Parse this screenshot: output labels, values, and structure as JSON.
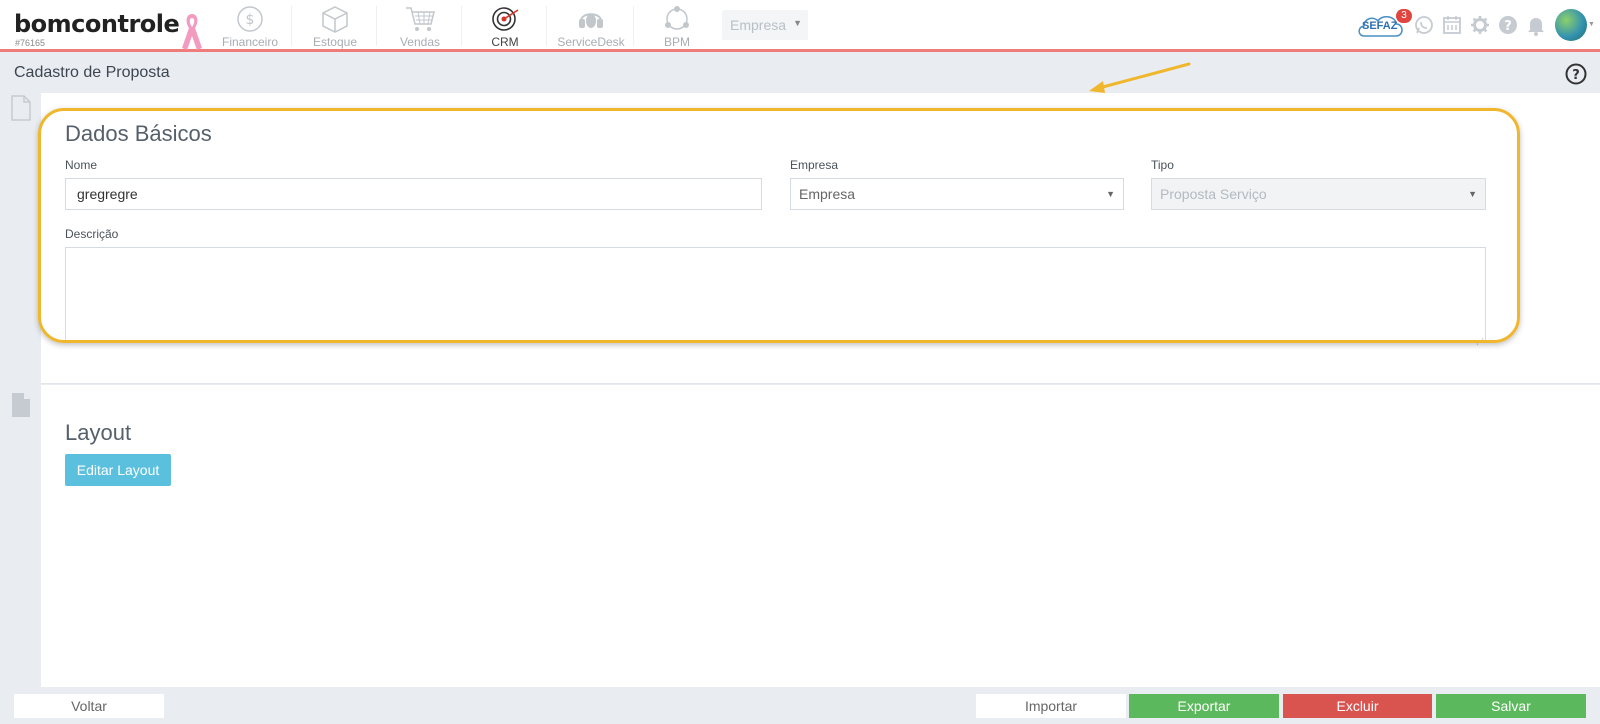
{
  "header": {
    "logo_text": "bomcontrole",
    "account_id": "#76165",
    "modules": [
      {
        "label": "Financeiro",
        "icon": "coin-dollar-icon"
      },
      {
        "label": "Estoque",
        "icon": "box-icon"
      },
      {
        "label": "Vendas",
        "icon": "shopping-cart-icon"
      },
      {
        "label": "CRM",
        "icon": "target-icon",
        "active": true
      },
      {
        "label": "ServiceDesk",
        "icon": "headset-icon"
      },
      {
        "label": "BPM",
        "icon": "network-icon"
      }
    ],
    "company_select": "Empresa",
    "sefaz_label": "SEFAZ",
    "sefaz_badge": "3",
    "tools": [
      "whatsapp-icon",
      "calendar-icon",
      "gear-icon",
      "help-icon",
      "bell-icon"
    ]
  },
  "page": {
    "title": "Cadastro de Proposta"
  },
  "basic": {
    "title": "Dados Básicos",
    "name_label": "Nome",
    "name_value": "gregregre",
    "company_label": "Empresa",
    "company_value": "Empresa",
    "type_label": "Tipo",
    "type_value": "Proposta Serviço",
    "description_label": "Descrição",
    "description_value": ""
  },
  "layout": {
    "title": "Layout",
    "edit_button": "Editar Layout"
  },
  "footer": {
    "back": "Voltar",
    "import": "Importar",
    "export": "Exportar",
    "delete": "Excluir",
    "save": "Salvar"
  },
  "colors": {
    "accent_red": "#ef7b7b",
    "highlight": "#f0b72d",
    "info": "#5bc0de",
    "success": "#5cb85c",
    "danger": "#d9534f"
  }
}
